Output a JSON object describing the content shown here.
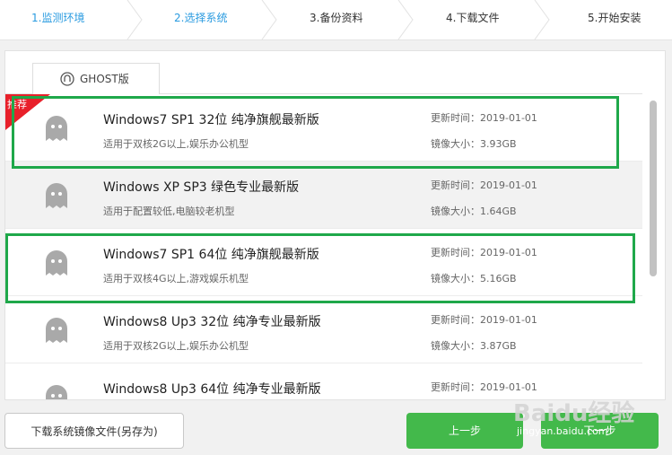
{
  "steps": [
    {
      "label": "1.监测环境",
      "state": "done"
    },
    {
      "label": "2.选择系统",
      "state": "done"
    },
    {
      "label": "3.备份资料",
      "state": "pending"
    },
    {
      "label": "4.下载文件",
      "state": "pending"
    },
    {
      "label": "5.开始安装",
      "state": "pending"
    }
  ],
  "tab": {
    "label": "GHOST版",
    "icon": "ghost-logo-icon"
  },
  "badge": {
    "label": "推荐",
    "color": "#e8202a"
  },
  "systems": [
    {
      "title": "Windows7 SP1 32位 纯净旗舰最新版",
      "desc": "适用于双核2G以上,娱乐办公机型",
      "updated": "更新时间：2019-01-01",
      "size": "镜像大小：3.93GB"
    },
    {
      "title": "Windows XP SP3 绿色专业最新版",
      "desc": "适用于配置较低,电脑较老机型",
      "updated": "更新时间：2019-01-01",
      "size": "镜像大小：1.64GB"
    },
    {
      "title": "Windows7 SP1 64位 纯净旗舰最新版",
      "desc": "适用于双核4G以上,游戏娱乐机型",
      "updated": "更新时间：2019-01-01",
      "size": "镜像大小：5.16GB"
    },
    {
      "title": "Windows8 Up3 32位 纯净专业最新版",
      "desc": "适用于双核2G以上,娱乐办公机型",
      "updated": "更新时间：2019-01-01",
      "size": "镜像大小：3.87GB"
    },
    {
      "title": "Windows8 Up3 64位 纯净专业最新版",
      "desc": "",
      "updated": "更新时间：2019-01-01",
      "size": ""
    }
  ],
  "footer": {
    "save_label": "下载系统镜像文件(另存为)",
    "prev_label": "上一步",
    "next_label": "下一步"
  },
  "watermark": {
    "main": "Baidu经验",
    "sub": "jingyan.baidu.com"
  },
  "colors": {
    "accent_blue": "#2a9be0",
    "highlight_green": "#1fa84a",
    "button_green": "#43b94b"
  }
}
